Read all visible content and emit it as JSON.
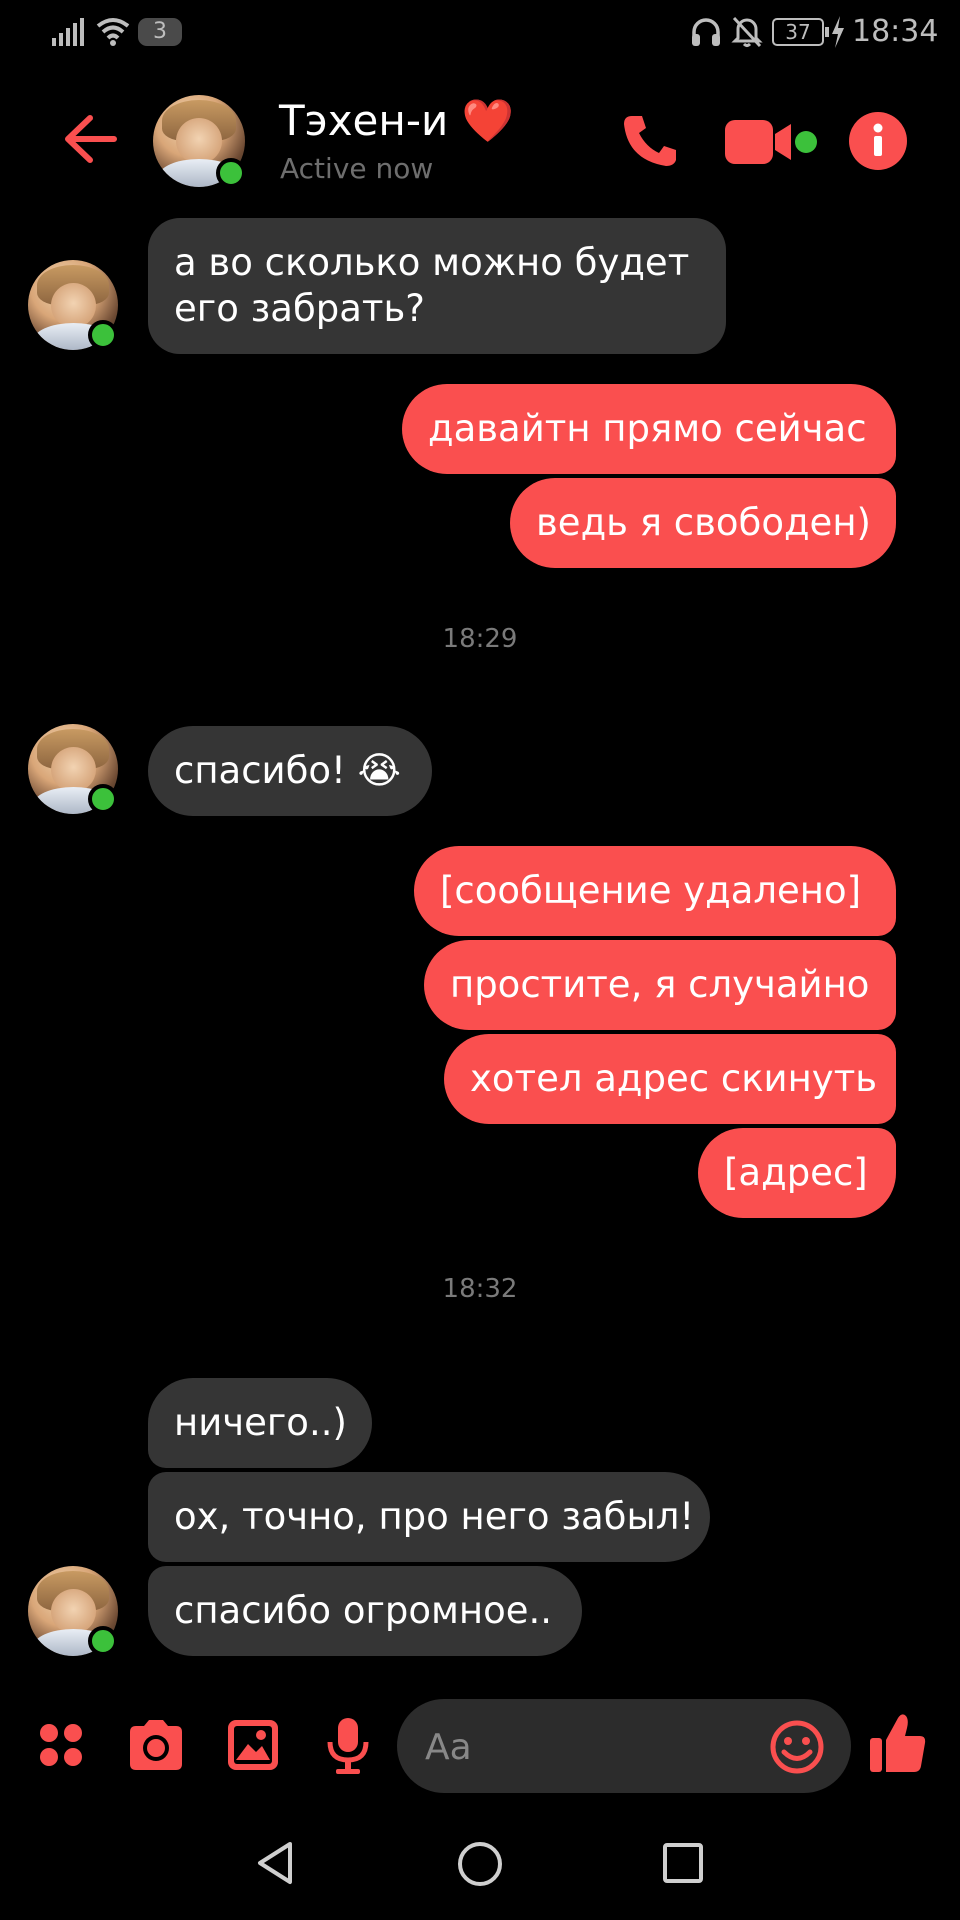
{
  "status_bar": {
    "sim_label": "3",
    "battery": "37",
    "time": "18:34"
  },
  "header": {
    "contact_name": "Тэхен-и",
    "heart": "❤️",
    "status": "Active now"
  },
  "messages": [
    {
      "side": "in",
      "lines": [
        "а во сколько можно будет",
        "его забрать?"
      ]
    },
    {
      "side": "out",
      "text": "давайтн прямо сейчас"
    },
    {
      "side": "out",
      "text": "ведь я свободен)"
    },
    {
      "side": "time",
      "text": "18:29"
    },
    {
      "side": "in",
      "text": "спасибо! 😭"
    },
    {
      "side": "out",
      "text": "[сообщение удалено]"
    },
    {
      "side": "out",
      "text": "простите, я случайно"
    },
    {
      "side": "out",
      "text": "хотел адрес скинуть"
    },
    {
      "side": "out",
      "text": "[адрес]"
    },
    {
      "side": "time",
      "text": "18:32"
    },
    {
      "side": "in",
      "text": "ничего..)"
    },
    {
      "side": "in",
      "text": "ох, точно, про него забыл!"
    },
    {
      "side": "in",
      "text": "спасибо огромное.."
    }
  ],
  "composer": {
    "placeholder": "Aa"
  },
  "colors": {
    "accent": "#fa4f4f",
    "incoming_bubble": "#353535",
    "online": "#3cc13b",
    "background": "#000000"
  },
  "icons": [
    "back-arrow-icon",
    "phone-icon",
    "video-camera-icon",
    "info-icon",
    "apps-grid-icon",
    "camera-icon",
    "gallery-icon",
    "microphone-icon",
    "emoji-icon",
    "thumbs-up-icon",
    "nav-back-icon",
    "nav-home-icon",
    "nav-recents-icon"
  ]
}
